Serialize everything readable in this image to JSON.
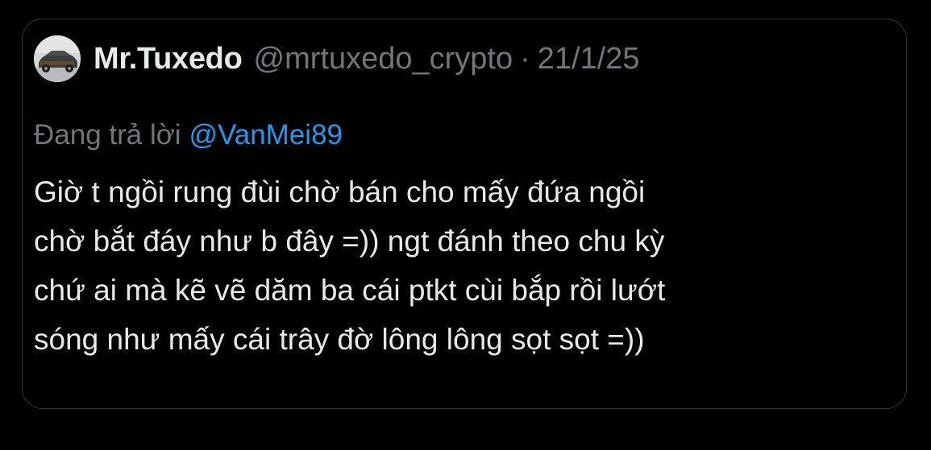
{
  "tweet": {
    "author": {
      "display_name": "Mr.Tuxedo",
      "handle": "@mrtuxedo_crypto",
      "separator": "·",
      "date": "21/1/25"
    },
    "reply": {
      "prefix": "Đang trả lời",
      "mention": "@VanMei89"
    },
    "body_lines": [
      "Giờ t ngồi rung đùi chờ bán cho mấy đứa ngồi",
      "chờ bắt đáy như b đây =)) ngt đánh theo chu kỳ",
      "chứ ai mà kẽ vẽ dăm ba cái ptkt cùi bắp rồi lướt",
      "sóng như mấy cái trây đờ lông lông sọt sọt =))"
    ]
  },
  "colors": {
    "background": "#000000",
    "border": "#2f3336",
    "primary_text": "#e7e9ea",
    "secondary_text": "#71767b",
    "mention": "#1d9bf0"
  },
  "icons": {
    "avatar": "profile-photo-car"
  }
}
